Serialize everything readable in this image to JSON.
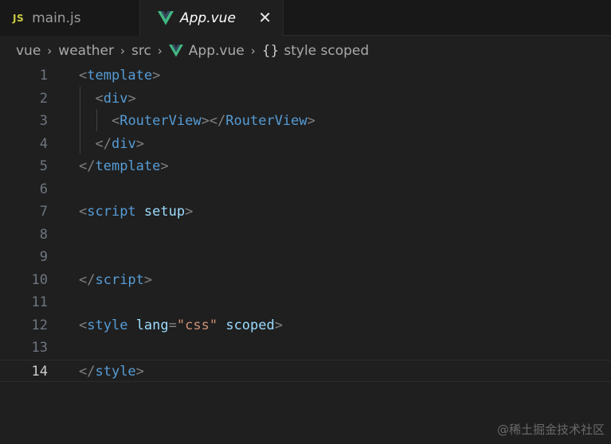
{
  "tabs": [
    {
      "icon": "JS",
      "label": "main.js",
      "active": false
    },
    {
      "icon": "vue-logo",
      "label": "App.vue",
      "active": true
    }
  ],
  "close_glyph": "✕",
  "breadcrumb": {
    "items": [
      "vue",
      "weather",
      "src",
      "App.vue",
      "style scoped"
    ],
    "braces": "{}",
    "separator": "›"
  },
  "editor": {
    "current_line": 14,
    "lines": [
      {
        "number": "1",
        "tokens": [
          [
            "punct",
            "<"
          ],
          [
            "tag",
            "template"
          ],
          [
            "punct",
            ">"
          ]
        ]
      },
      {
        "number": "2",
        "tokens": [
          [
            "",
            "  "
          ],
          [
            "punct",
            "<"
          ],
          [
            "tag",
            "div"
          ],
          [
            "punct",
            ">"
          ]
        ]
      },
      {
        "number": "3",
        "tokens": [
          [
            "",
            "    "
          ],
          [
            "punct",
            "<"
          ],
          [
            "tag",
            "RouterView"
          ],
          [
            "punct",
            "></"
          ],
          [
            "tag",
            "RouterView"
          ],
          [
            "punct",
            ">"
          ]
        ]
      },
      {
        "number": "4",
        "tokens": [
          [
            "",
            "  "
          ],
          [
            "punct",
            "</"
          ],
          [
            "tag",
            "div"
          ],
          [
            "punct",
            ">"
          ]
        ]
      },
      {
        "number": "5",
        "tokens": [
          [
            "punct",
            "</"
          ],
          [
            "tag",
            "template"
          ],
          [
            "punct",
            ">"
          ]
        ]
      },
      {
        "number": "6",
        "tokens": []
      },
      {
        "number": "7",
        "tokens": [
          [
            "punct",
            "<"
          ],
          [
            "tag",
            "script"
          ],
          [
            "",
            " "
          ],
          [
            "attr",
            "setup"
          ],
          [
            "punct",
            ">"
          ]
        ]
      },
      {
        "number": "8",
        "tokens": []
      },
      {
        "number": "9",
        "tokens": []
      },
      {
        "number": "10",
        "tokens": [
          [
            "punct",
            "</"
          ],
          [
            "tag",
            "script"
          ],
          [
            "punct",
            ">"
          ]
        ]
      },
      {
        "number": "11",
        "tokens": []
      },
      {
        "number": "12",
        "tokens": [
          [
            "punct",
            "<"
          ],
          [
            "tag",
            "style"
          ],
          [
            "",
            " "
          ],
          [
            "attr",
            "lang"
          ],
          [
            "punct",
            "="
          ],
          [
            "str",
            "\"css\""
          ],
          [
            "",
            " "
          ],
          [
            "attr",
            "scoped"
          ],
          [
            "punct",
            ">"
          ]
        ]
      },
      {
        "number": "13",
        "tokens": []
      },
      {
        "number": "14",
        "tokens": [
          [
            "punct",
            "</"
          ],
          [
            "tag",
            "style"
          ],
          [
            "punct",
            ">"
          ]
        ]
      }
    ]
  },
  "watermark": "@稀土掘金技术社区",
  "colors": {
    "background": "#1f1f1f",
    "tag": "#569cd6",
    "attribute": "#9cdcfe",
    "string": "#ce9178",
    "punctuation": "#808080",
    "js_icon": "#cbcb41",
    "vue_green": "#41b883"
  }
}
